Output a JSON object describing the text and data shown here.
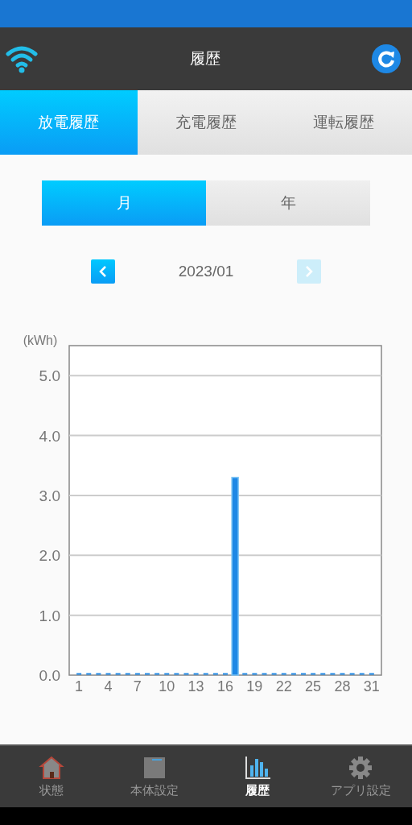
{
  "header": {
    "title": "履歴"
  },
  "tabs": [
    {
      "label": "放電履歴",
      "selected": true
    },
    {
      "label": "充電履歴",
      "selected": false
    },
    {
      "label": "運転履歴",
      "selected": false
    }
  ],
  "period": [
    {
      "label": "月",
      "selected": true
    },
    {
      "label": "年",
      "selected": false
    }
  ],
  "date_nav": {
    "label": "2023/01",
    "prev_disabled": false,
    "next_disabled": true
  },
  "chart": {
    "chart_data": {
      "type": "bar",
      "ylabel": "(kWh)",
      "x": [
        1,
        2,
        3,
        4,
        5,
        6,
        7,
        8,
        9,
        10,
        11,
        12,
        13,
        14,
        15,
        16,
        17,
        18,
        19,
        20,
        21,
        22,
        23,
        24,
        25,
        26,
        27,
        28,
        29,
        30,
        31
      ],
      "grid": true,
      "xlim": [
        0,
        32
      ],
      "series": [
        {
          "color": "#1e88e5",
          "values": [
            0,
            0,
            0,
            0,
            0,
            0,
            0,
            0,
            0,
            0,
            0,
            0,
            0,
            0,
            0,
            0,
            3.3,
            0,
            0,
            0,
            0,
            0,
            0,
            0,
            0,
            0,
            0,
            0,
            0,
            0,
            0
          ]
        }
      ],
      "ylim": [
        0,
        5.5
      ],
      "yticks": [
        {
          "value": 0,
          "label": "0.0"
        },
        {
          "value": 1,
          "label": "1.0"
        },
        {
          "value": 2,
          "label": "2.0"
        },
        {
          "value": 3,
          "label": "3.0"
        },
        {
          "value": 4,
          "label": "4.0"
        },
        {
          "value": 5,
          "label": "5.0"
        }
      ],
      "xticks": [
        1,
        4,
        7,
        10,
        13,
        16,
        19,
        22,
        25,
        28,
        31
      ]
    }
  },
  "bottom_nav": [
    {
      "kind": "house",
      "label": "状態",
      "selected": false
    },
    {
      "kind": "unit",
      "label": "本体設定",
      "selected": false
    },
    {
      "kind": "history",
      "label": "履歴",
      "selected": true
    },
    {
      "kind": "gear",
      "label": "アプリ設定",
      "selected": false
    }
  ]
}
